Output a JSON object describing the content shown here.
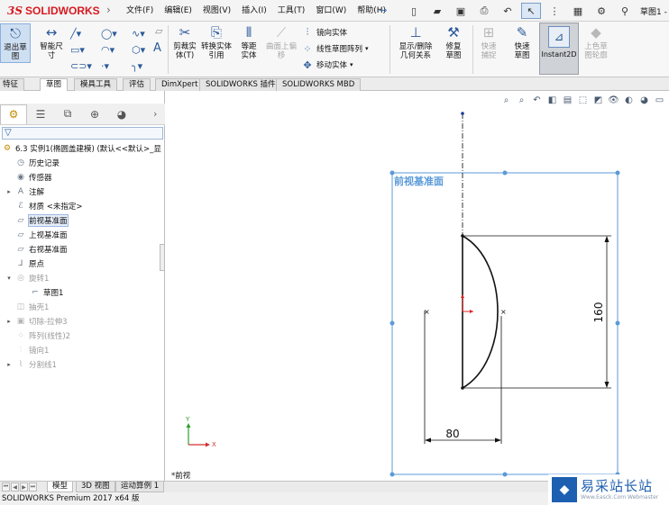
{
  "app": {
    "brand_mark": "3S",
    "brand_name": "SOLIDWORKS",
    "doc_title": "草图1 -"
  },
  "menu": [
    "文件(F)",
    "编辑(E)",
    "视图(V)",
    "插入(I)",
    "工具(T)",
    "窗口(W)",
    "帮助(H)"
  ],
  "ribbon": {
    "exit_sketch": "退出草图",
    "smart_dim": "智能尺寸",
    "trim": "剪裁实体(T)",
    "convert": "转换实体引用",
    "offset": "等距实体",
    "surface_offset": "曲面上偏移",
    "mirror": "镜向实体",
    "linear_pattern": "线性草图阵列",
    "move": "移动实体",
    "relations": "显示/删除几何关系",
    "repair": "修复草图",
    "quick_snap": "快速捕捉",
    "rapid_sketch": "快速草图",
    "instant2d": "Instant2D",
    "color_sketch": "上色草图轮廓"
  },
  "tabs": [
    "特征",
    "草图",
    "模具工具",
    "评估",
    "DimXpert",
    "SOLIDWORKS 插件",
    "SOLIDWORKS MBD"
  ],
  "active_tab": "草图",
  "tree": {
    "root": "6.3 实例1(椭圆盖建模) (默认<<默认>_显",
    "items": [
      {
        "label": "历史记录",
        "icon": "history-icon"
      },
      {
        "label": "传感器",
        "icon": "sensor-icon"
      },
      {
        "label": "注解",
        "icon": "annotation-icon"
      },
      {
        "label": "材质 <未指定>",
        "icon": "material-icon"
      },
      {
        "label": "前视基准面",
        "icon": "plane-icon"
      },
      {
        "label": "上视基准面",
        "icon": "plane-icon"
      },
      {
        "label": "右视基准面",
        "icon": "plane-icon"
      },
      {
        "label": "原点",
        "icon": "origin-icon"
      },
      {
        "label": "旋转1",
        "icon": "revolve-icon"
      },
      {
        "label": "草图1",
        "icon": "sketch-icon"
      },
      {
        "label": "抽壳1",
        "icon": "shell-icon"
      },
      {
        "label": "切除-拉伸3",
        "icon": "cut-extrude-icon"
      },
      {
        "label": "阵列(线性)2",
        "icon": "pattern-icon"
      },
      {
        "label": "镜向1",
        "icon": "mirror-icon"
      },
      {
        "label": "分割线1",
        "icon": "split-line-icon"
      }
    ]
  },
  "graphics": {
    "plane_label": "前视基准面",
    "dim_vertical": "160",
    "dim_horizontal": "80",
    "view_label": "*前视",
    "triad_y": "Y",
    "triad_x": "X"
  },
  "bottom_tabs": [
    "模型",
    "3D 视图",
    "运动算例 1"
  ],
  "status": "SOLIDWORKS Premium 2017 x64 版",
  "watermark": {
    "cn": "易采站长站",
    "en": "Www.Easck.Com Webmaster"
  },
  "colors": {
    "plane": "#5a9ad8",
    "sketch": "#111111",
    "brand": "#d71920",
    "origin": "#e02020"
  }
}
